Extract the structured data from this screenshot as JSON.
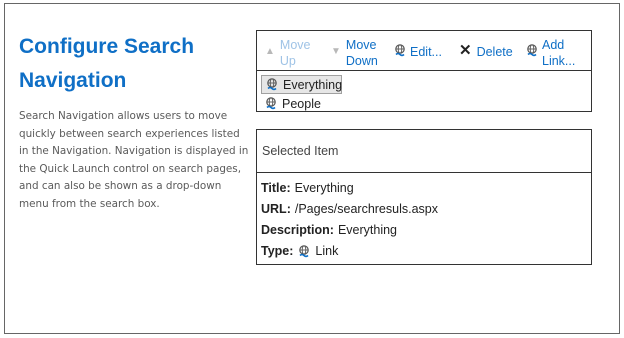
{
  "page": {
    "title_line1": "Configure Search",
    "title_line2": "Navigation",
    "description": "Search Navigation allows users to move quickly between search experiences listed in the Navigation. Navigation is displayed in the Quick Launch control on search pages, and can also be shown as a drop-down menu from the search box."
  },
  "toolbar": {
    "move_up": [
      "Move",
      "Up"
    ],
    "move_down": [
      "Move",
      "Down"
    ],
    "edit": "Edit...",
    "delete": "Delete",
    "add_link": [
      "Add",
      "Link..."
    ]
  },
  "nav_items": [
    {
      "label": "Everything",
      "selected": true
    },
    {
      "label": "People",
      "selected": false
    }
  ],
  "selected_item": {
    "header": "Selected Item",
    "title_label": "Title:",
    "title_value": "Everything",
    "url_label": "URL:",
    "url_value": "/Pages/searchresuls.aspx",
    "description_label": "Description:",
    "description_value": "Everything",
    "type_label": "Type:",
    "type_value": "Link"
  },
  "colors": {
    "accent": "#0f6fc6",
    "disabled": "#9fc3e6",
    "text": "#222222",
    "desc": "#5a5a5a"
  }
}
